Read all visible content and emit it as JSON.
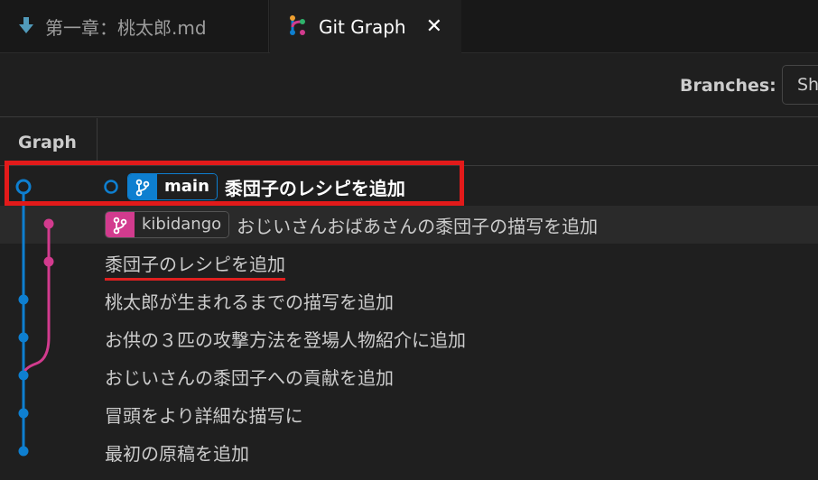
{
  "tabs": [
    {
      "label": "第一章：桃太郎.md",
      "icon": "markdown-arrow-icon",
      "active": false
    },
    {
      "label": "Git Graph",
      "icon": "git-graph-icon",
      "active": true,
      "close": "✕"
    }
  ],
  "toolbar": {
    "branches_label": "Branches:",
    "branches_value": "Show All"
  },
  "table": {
    "graph_header": "Graph"
  },
  "refs": {
    "main": "main",
    "kibidango": "kibidango"
  },
  "commits": [
    {
      "message": "黍団子のレシピを追加",
      "branch": "main"
    },
    {
      "message": "おじいさんおばあさんの黍団子の描写を追加",
      "branch": "kibidango"
    },
    {
      "message": "黍団子のレシピを追加"
    },
    {
      "message": "桃太郎が生まれるまでの描写を追加"
    },
    {
      "message": "お供の３匹の攻撃方法を登場人物紹介に追加"
    },
    {
      "message": "おじいさんの黍団子への貢献を追加"
    },
    {
      "message": "冒頭をより詳細な描写に"
    },
    {
      "message": "最初の原稿を追加"
    }
  ],
  "colors": {
    "main_branch": "#0e7fd0",
    "kibidango_branch": "#d23b8e",
    "annotation": "#e21a1a",
    "background": "#1f1f1f"
  }
}
